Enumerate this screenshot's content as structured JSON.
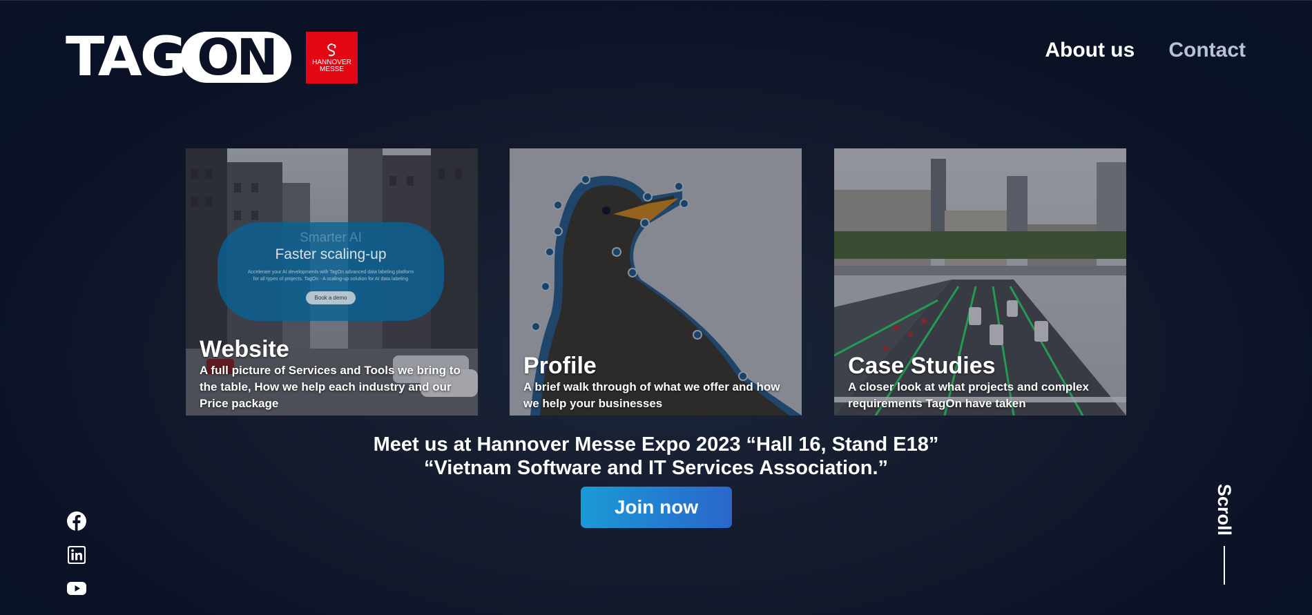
{
  "brand": {
    "logo_text": "TAG",
    "logo_on": "ON",
    "partner_badge": {
      "line1": "HANNOVER",
      "line2": "MESSE",
      "color": "#e30613"
    }
  },
  "nav": {
    "about_label": "About us",
    "contact_label": "Contact"
  },
  "cards": [
    {
      "title": "Website",
      "description": "A full picture of Services and Tools we bring to the table, How we help each industry and our Price package",
      "mock": {
        "heading_faded": "Smarter AI",
        "heading": "Faster scaling-up",
        "body": "Accelerate your AI developments with TagOn advanced data labeling platform for all types of projects. TagOn - A scaling-up solution for AI data labeling",
        "button": "Book a demo"
      }
    },
    {
      "title": "Profile",
      "description": "A brief walk through of what we offer and how we help your businesses"
    },
    {
      "title": "Case Studies",
      "description": "A closer look at what projects and complex requirements TagOn have taken"
    }
  ],
  "expo": {
    "line1": "Meet us at Hannover Messe Expo 2023 “Hall 16, Stand E18”",
    "line2": "“Vietnam Software and IT Services Association.”",
    "cta_label": "Join now"
  },
  "social": [
    "facebook-icon",
    "linkedin-icon",
    "youtube-icon"
  ],
  "scroll": {
    "label": "Scroll"
  },
  "colors": {
    "background": "#0b1226",
    "accent_start": "#1b9ad6",
    "accent_end": "#2a66c9",
    "nav_muted": "#b8c2d2"
  }
}
